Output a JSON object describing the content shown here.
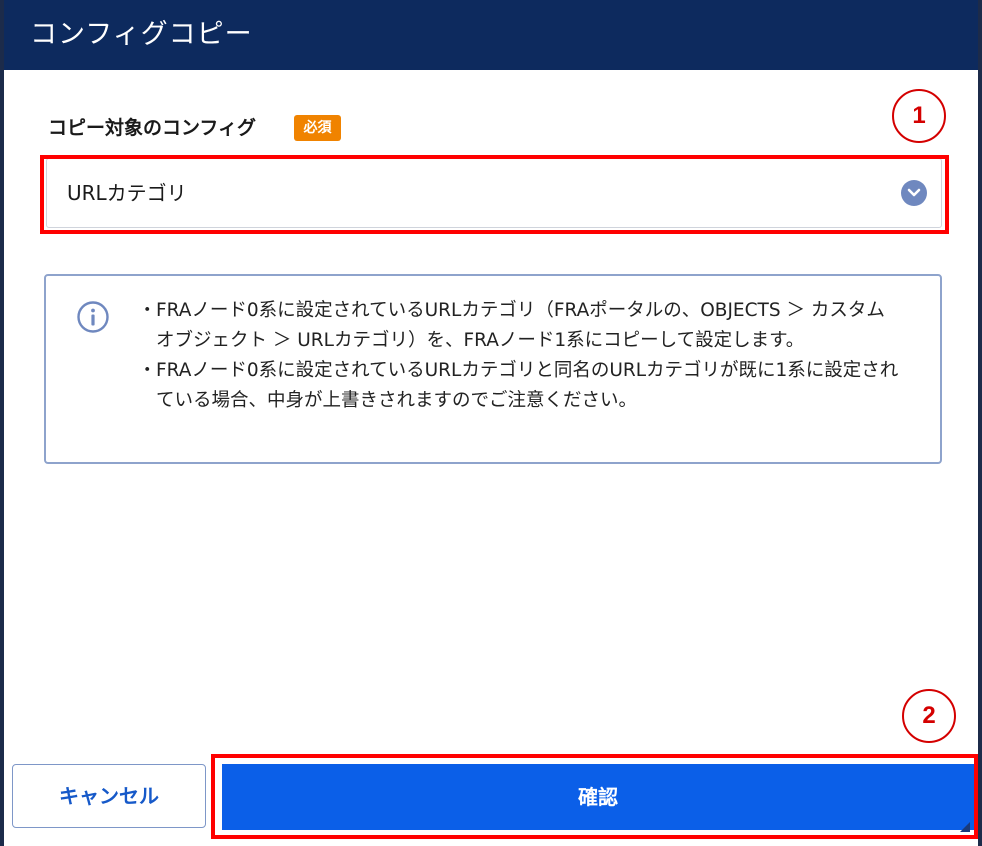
{
  "dialog": {
    "title": "コンフィグコピー"
  },
  "form": {
    "field_label": "コピー対象のコンフィグ",
    "required_badge": "必須",
    "selected_value": "URLカテゴリ"
  },
  "info": {
    "lines": [
      {
        "bullet": "・",
        "text": "FRAノード0系に設定されているURLカテゴリ（FRAポータルの、OBJECTS ＞ カスタム オブジェクト ＞ URLカテゴリ）を、FRAノード1系にコピーして設定します。"
      },
      {
        "bullet": "・",
        "text": "FRAノード0系に設定されているURLカテゴリと同名のURLカテゴリが既に1系に設定されている場合、中身が上書きされますのでご注意ください。"
      }
    ]
  },
  "annotations": {
    "marker_1": "1",
    "marker_2": "2"
  },
  "buttons": {
    "cancel_label": "キャンセル",
    "confirm_label": "確認"
  },
  "colors": {
    "header_bg": "#0d2a5e",
    "primary": "#0b5fe8",
    "required": "#f08300",
    "annotation": "#ff0000"
  },
  "icons": {
    "dropdown": "chevron-down-icon",
    "info": "info-icon"
  }
}
